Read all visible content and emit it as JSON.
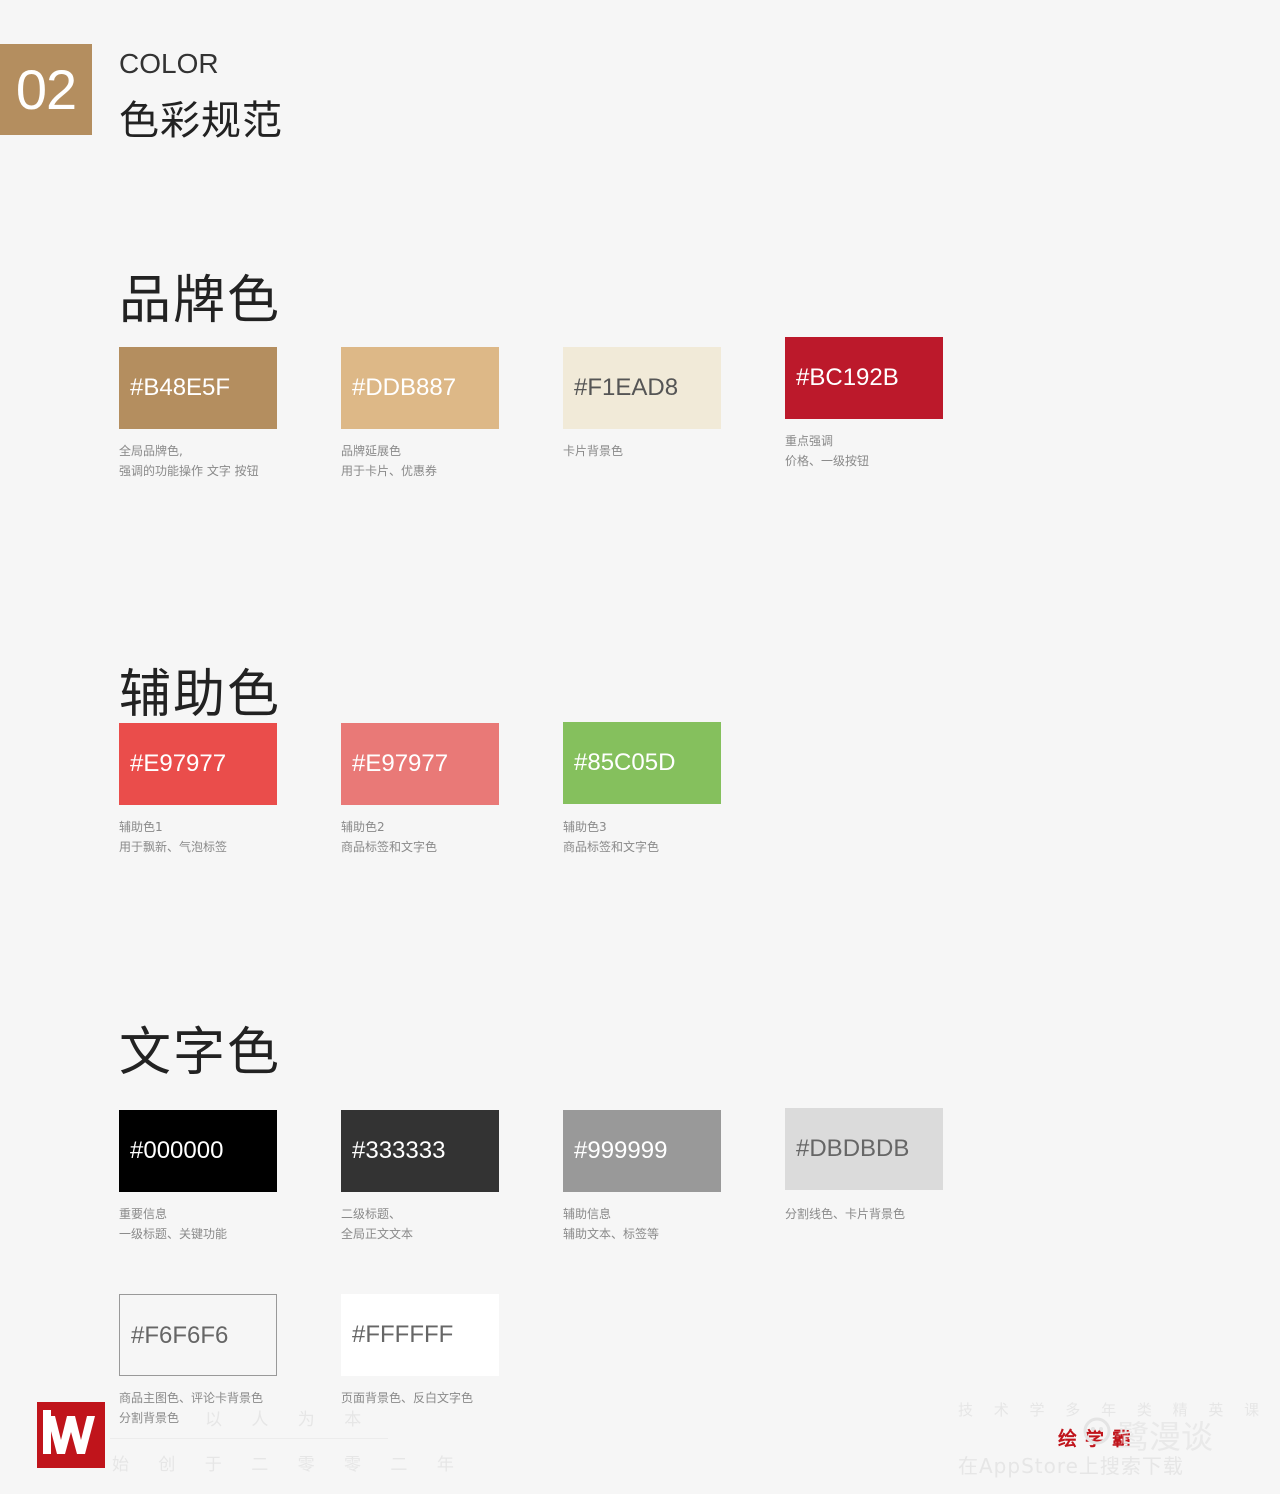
{
  "header": {
    "number": "02",
    "title_en": "COLOR",
    "title_cn": "色彩规范"
  },
  "sections": {
    "brand": {
      "title": "品牌色",
      "swatches": [
        {
          "hex": "#B48E5F",
          "desc": [
            "全局品牌色,",
            "强调的功能操作 文字 按钮"
          ]
        },
        {
          "hex": "#DDB887",
          "desc": [
            "品牌延展色",
            "用于卡片、优惠券"
          ]
        },
        {
          "hex": "#F1EAD8",
          "desc": [
            "卡片背景色"
          ]
        },
        {
          "hex": "#BC192B",
          "desc": [
            "重点强调",
            "价格、一级按钮"
          ]
        }
      ]
    },
    "auxiliary": {
      "title": "辅助色",
      "swatches": [
        {
          "hex": "#E97977",
          "fill": "#ea4d4b",
          "desc": [
            "辅助色1",
            "用于飘新、气泡标签"
          ]
        },
        {
          "hex": "#E97977",
          "fill": "#e97977",
          "desc": [
            "辅助色2",
            "商品标签和文字色"
          ]
        },
        {
          "hex": "#85C05D",
          "fill": "#85c05d",
          "desc": [
            "辅助色3",
            "商品标签和文字色"
          ]
        }
      ]
    },
    "text": {
      "title": "文字色",
      "swatches": [
        {
          "hex": "#000000",
          "desc": [
            "重要信息",
            "一级标题、关键功能"
          ]
        },
        {
          "hex": "#333333",
          "desc": [
            "二级标题、",
            "全局正文文本"
          ]
        },
        {
          "hex": "#999999",
          "desc": [
            "辅助信息",
            "辅助文本、标签等"
          ]
        },
        {
          "hex": "#DBDBDB",
          "desc": [
            "分割线色、卡片背景色"
          ]
        },
        {
          "hex": "#F6F6F6",
          "desc": [
            "商品主图色、评论卡背景色",
            "分割背景色"
          ]
        },
        {
          "hex": "#FFFFFF",
          "desc": [
            "页面背景色、反白文字色"
          ]
        }
      ]
    }
  },
  "footer": {
    "left_line1": "以 人 为 本",
    "left_line2": "始 创 于 二 零 零 二 年",
    "brand": "绘学霸",
    "watermark": "鹭漫谈",
    "right_line1": "技 术 学 多 年 类 精 英 课 程",
    "right_line2": "在AppStore上搜索下载"
  }
}
